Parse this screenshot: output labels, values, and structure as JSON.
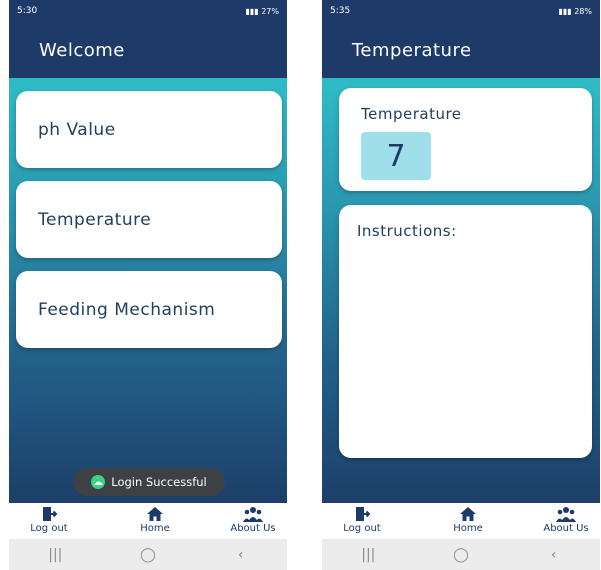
{
  "left_screen": {
    "status_time": "5:30",
    "status_right": "27%",
    "title": "Welcome",
    "menu": [
      {
        "label": "ph Value"
      },
      {
        "label": "Temperature"
      },
      {
        "label": "Feeding Mechanism"
      }
    ],
    "toast": "Login Successful"
  },
  "right_screen": {
    "status_time": "5:35",
    "status_right": "28%",
    "title": "Temperature",
    "temperature_label": "Temperature",
    "temperature_value": "7",
    "instructions_label": "Instructions:"
  },
  "bottom_nav": {
    "logout": "Log out",
    "home": "Home",
    "about": "About Us"
  },
  "colors": {
    "header": "#1e3a69",
    "accent": "#2fbcc6",
    "value_box": "#9fdfe9",
    "toast_icon": "#3bd188"
  },
  "icons": {
    "logout": "logout-icon",
    "home": "home-icon",
    "about": "group-icon"
  }
}
